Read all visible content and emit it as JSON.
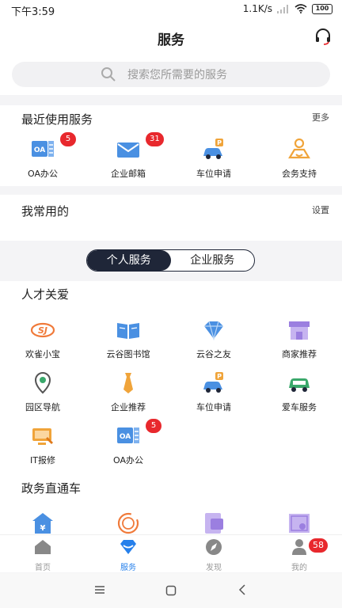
{
  "status": {
    "time": "下午3:59",
    "speed": "1.1K/s",
    "battery": "100"
  },
  "header": {
    "title": "服务"
  },
  "search": {
    "placeholder": "搜索您所需要的服务"
  },
  "recent": {
    "title": "最近使用服务",
    "more": "更多",
    "items": [
      {
        "label": "OA办公",
        "icon": "oa-icon",
        "badge": "5"
      },
      {
        "label": "企业邮箱",
        "icon": "mail-icon",
        "badge": "31"
      },
      {
        "label": "车位申请",
        "icon": "car-parking-icon",
        "badge": ""
      },
      {
        "label": "会务支持",
        "icon": "meeting-support-icon",
        "badge": ""
      }
    ]
  },
  "favorites": {
    "title": "我常用的",
    "settings": "设置"
  },
  "tabs": [
    {
      "label": "个人服务",
      "active": true
    },
    {
      "label": "企业服务",
      "active": false
    }
  ],
  "talent": {
    "title": "人才关爱",
    "items": [
      {
        "label": "欢雀小宝",
        "icon": "sj-logo-icon",
        "badge": ""
      },
      {
        "label": "云谷图书馆",
        "icon": "book-icon",
        "badge": ""
      },
      {
        "label": "云谷之友",
        "icon": "diamond-icon",
        "badge": ""
      },
      {
        "label": "商家推荐",
        "icon": "shop-icon",
        "badge": ""
      },
      {
        "label": "园区导航",
        "icon": "map-pin-icon",
        "badge": ""
      },
      {
        "label": "企业推荐",
        "icon": "tie-icon",
        "badge": ""
      },
      {
        "label": "车位申请",
        "icon": "car-parking-icon",
        "badge": ""
      },
      {
        "label": "爱车服务",
        "icon": "car-service-icon",
        "badge": ""
      },
      {
        "label": "IT报修",
        "icon": "it-repair-icon",
        "badge": ""
      },
      {
        "label": "OA办公",
        "icon": "oa-icon",
        "badge": "5"
      }
    ]
  },
  "government": {
    "title": "政务直通车",
    "items": [
      {
        "icon": "tax-house-icon"
      },
      {
        "icon": "enterprise-icon"
      },
      {
        "icon": "rent-icon"
      },
      {
        "icon": "certificate-icon"
      }
    ]
  },
  "bottom_nav": [
    {
      "label": "首页",
      "icon": "home-icon",
      "active": false,
      "badge": ""
    },
    {
      "label": "服务",
      "icon": "service-diamond-icon",
      "active": true,
      "badge": ""
    },
    {
      "label": "发现",
      "icon": "compass-icon",
      "active": false,
      "badge": ""
    },
    {
      "label": "我的",
      "icon": "user-icon",
      "active": false,
      "badge": "58"
    }
  ],
  "colors": {
    "accent": "#2680eb",
    "dark": "#1f2638",
    "badge": "#e8282d",
    "orange": "#f0a43a"
  }
}
